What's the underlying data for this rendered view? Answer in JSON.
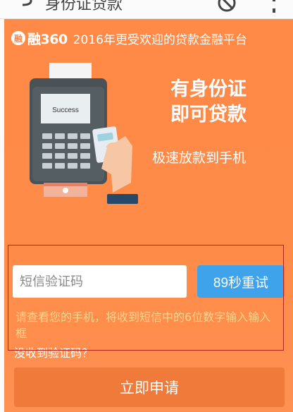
{
  "topbar": {
    "title": "身份证贷款",
    "icons": [
      "back-icon",
      "block-icon",
      "more-icon"
    ]
  },
  "brand": {
    "logo_text": "融",
    "name": "融360",
    "slogan": "2016年更受欢迎的贷款金融平台"
  },
  "banner": {
    "headline_line1": "有身份证",
    "headline_line2": "即可贷款",
    "subheadline": "极速放款到手机",
    "pos_screen_text": "Success"
  },
  "form": {
    "sms_placeholder": "短信验证码",
    "resend_label": "89秒重试",
    "hint": "请查看您的手机，将收到短信中的6位数字输入输入框",
    "no_code_label": "没收到验证码？",
    "apply_label": "立即申请"
  },
  "colors": {
    "panel_orange": "#ff8a47",
    "resend_blue": "#3fa3ec",
    "hint_yellow": "#ffd58c",
    "apply_orange": "#f07a3a",
    "annotation_red": "#b3221b"
  }
}
